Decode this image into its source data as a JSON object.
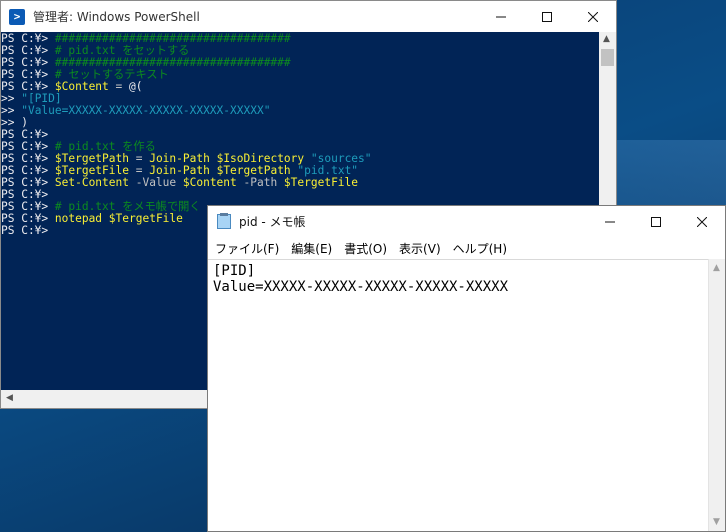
{
  "powershell": {
    "title": "管理者: Windows PowerShell",
    "icon": "powershell-icon",
    "lines": [
      [
        {
          "t": "PS C:¥> ",
          "c": "prompt"
        },
        {
          "t": "###################################",
          "c": "comment"
        }
      ],
      [
        {
          "t": "PS C:¥> ",
          "c": "prompt"
        },
        {
          "t": "# pid.txt をセットする",
          "c": "comment"
        }
      ],
      [
        {
          "t": "PS C:¥> ",
          "c": "prompt"
        },
        {
          "t": "###################################",
          "c": "comment"
        }
      ],
      [
        {
          "t": "PS C:¥> ",
          "c": "prompt"
        },
        {
          "t": "# セットするテキスト",
          "c": "comment"
        }
      ],
      [
        {
          "t": "PS C:¥> ",
          "c": "prompt"
        },
        {
          "t": "$Content",
          "c": "var"
        },
        {
          "t": " = ",
          "c": "op"
        },
        {
          "t": "@(",
          "c": "prompt"
        }
      ],
      [
        {
          "t": ">> ",
          "c": "prompt"
        },
        {
          "t": "\"[PID]",
          "c": "str"
        }
      ],
      [
        {
          "t": ">> ",
          "c": "prompt"
        },
        {
          "t": "\"Value=XXXXX-XXXXX-XXXXX-XXXXX-XXXXX\"",
          "c": "str"
        }
      ],
      [
        {
          "t": ">> )",
          "c": "prompt"
        }
      ],
      [
        {
          "t": "PS C:¥>",
          "c": "prompt"
        }
      ],
      [
        {
          "t": "PS C:¥> ",
          "c": "prompt"
        },
        {
          "t": "# pid.txt を作る",
          "c": "comment"
        }
      ],
      [
        {
          "t": "PS C:¥> ",
          "c": "prompt"
        },
        {
          "t": "$TergetPath",
          "c": "var"
        },
        {
          "t": " = ",
          "c": "op"
        },
        {
          "t": "Join-Path",
          "c": "cmd"
        },
        {
          "t": " ",
          "c": "op"
        },
        {
          "t": "$IsoDirectory",
          "c": "var"
        },
        {
          "t": " ",
          "c": "op"
        },
        {
          "t": "\"sources\"",
          "c": "str"
        }
      ],
      [
        {
          "t": "PS C:¥> ",
          "c": "prompt"
        },
        {
          "t": "$TergetFile",
          "c": "var"
        },
        {
          "t": " = ",
          "c": "op"
        },
        {
          "t": "Join-Path",
          "c": "cmd"
        },
        {
          "t": " ",
          "c": "op"
        },
        {
          "t": "$TergetPath",
          "c": "var"
        },
        {
          "t": " ",
          "c": "op"
        },
        {
          "t": "\"pid.txt\"",
          "c": "str"
        }
      ],
      [
        {
          "t": "PS C:¥> ",
          "c": "prompt"
        },
        {
          "t": "Set-Content",
          "c": "cmd"
        },
        {
          "t": " -Value ",
          "c": "param"
        },
        {
          "t": "$Content",
          "c": "var"
        },
        {
          "t": " -Path ",
          "c": "param"
        },
        {
          "t": "$TergetFile",
          "c": "var"
        }
      ],
      [
        {
          "t": "PS C:¥>",
          "c": "prompt"
        }
      ],
      [
        {
          "t": "PS C:¥> ",
          "c": "prompt"
        },
        {
          "t": "# pid.txt をメモ帳で開く",
          "c": "comment"
        }
      ],
      [
        {
          "t": "PS C:¥> ",
          "c": "prompt"
        },
        {
          "t": "notepad",
          "c": "cmd"
        },
        {
          "t": " ",
          "c": "op"
        },
        {
          "t": "$TergetFile",
          "c": "var"
        }
      ],
      [
        {
          "t": "PS C:¥>",
          "c": "prompt"
        }
      ]
    ]
  },
  "notepad": {
    "title": "pid - メモ帳",
    "icon": "notepad-icon",
    "menu": [
      "ファイル(F)",
      "編集(E)",
      "書式(O)",
      "表示(V)",
      "ヘルプ(H)"
    ],
    "content": "[PID]\nValue=XXXXX-XXXXX-XXXXX-XXXXX-XXXXX"
  },
  "colors": {
    "ps_background": "#012456",
    "ps_comment": "#0c8b1f",
    "ps_variable": "#f9ef34",
    "ps_string": "#1e9cbb"
  }
}
